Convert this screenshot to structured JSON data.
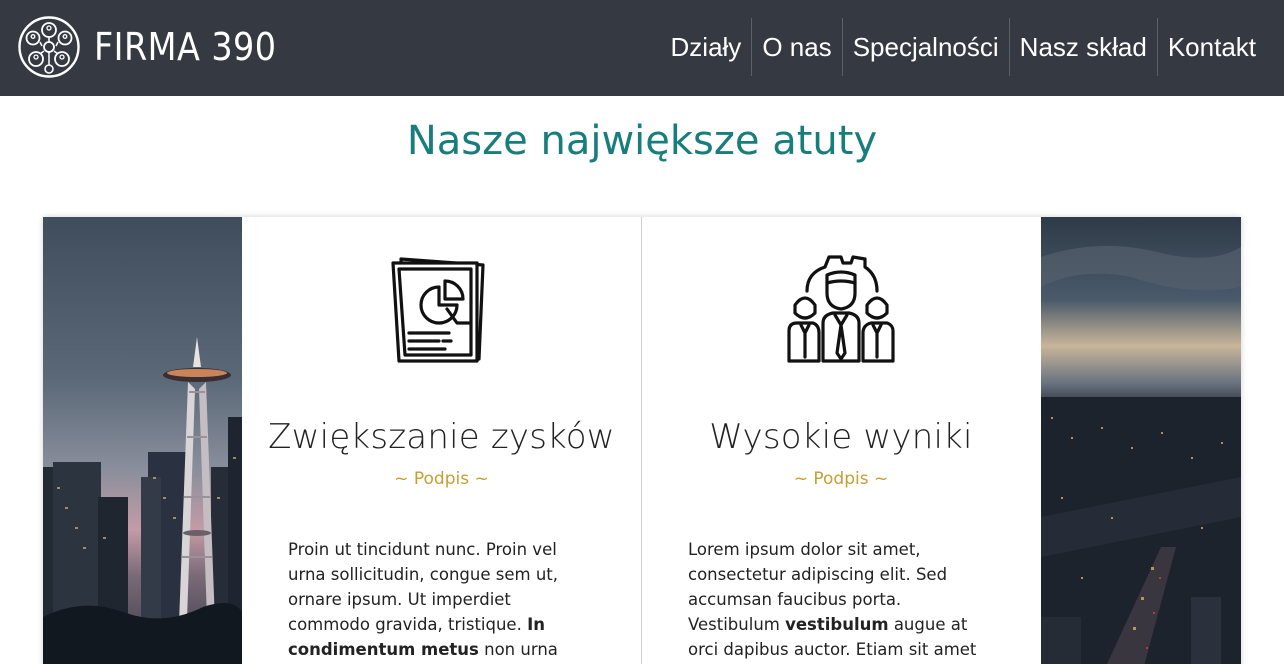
{
  "header": {
    "brand": "FIRMA 390",
    "nav": [
      "Działy",
      "O nas",
      "Specjalności",
      "Nasz skład",
      "Kontakt"
    ]
  },
  "main": {
    "title": "Nasze największe atuty",
    "cards": [
      {
        "icon": "documents-chart-icon",
        "title": "Zwiększanie zysków",
        "subtitle": "~ Podpis ~",
        "text_parts": [
          "Proin ut tincidunt nunc. Proin vel urna sollicitudin, congue sem ut, ornare ipsum. Ut imperdiet commodo gravida, tristique. ",
          "In condimentum metus",
          " non urna"
        ]
      },
      {
        "icon": "team-gear-icon",
        "title": "Wysokie wyniki",
        "subtitle": "~ Podpis ~",
        "text_parts": [
          "Lorem ipsum dolor sit amet, consectetur adipiscing elit. Sed accumsan faucibus porta. Vestibulum ",
          "vestibulum",
          " augue at orci dapibus auctor. Etiam sit amet"
        ]
      }
    ]
  },
  "colors": {
    "header_bg": "#353a42",
    "title": "#177e7c",
    "subtitle": "#c4a032"
  }
}
